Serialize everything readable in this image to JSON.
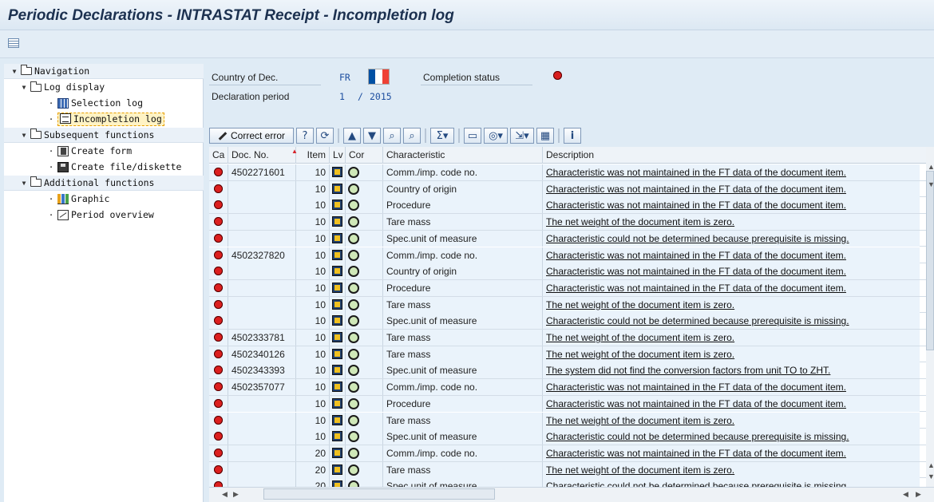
{
  "window": {
    "title": "Periodic Declarations - INTRASTAT Receipt - Incompletion log"
  },
  "navigation": [
    {
      "label": "Navigation",
      "type": "folder",
      "expanded": true,
      "level": 0
    },
    {
      "label": "Log display",
      "type": "folder",
      "expanded": true,
      "level": 1
    },
    {
      "label": "Selection log",
      "type": "item",
      "icon": "table-icon",
      "level": 2
    },
    {
      "label": "Incompletion log",
      "type": "item",
      "icon": "log-icon",
      "level": 2,
      "selected": true
    },
    {
      "label": "Subsequent functions",
      "type": "folder",
      "expanded": true,
      "level": 1
    },
    {
      "label": "Create form",
      "type": "item",
      "icon": "form-icon",
      "level": 2
    },
    {
      "label": "Create file/diskette",
      "type": "item",
      "icon": "disk-icon",
      "level": 2
    },
    {
      "label": "Additional functions",
      "type": "folder",
      "expanded": true,
      "level": 1
    },
    {
      "label": "Graphic",
      "type": "item",
      "icon": "graphic-icon",
      "level": 2
    },
    {
      "label": "Period overview",
      "type": "item",
      "icon": "overview-icon",
      "level": 2
    }
  ],
  "header": {
    "country_label": "Country of Dec.",
    "country_value": "FR",
    "completion_label": "Completion status",
    "period_label": "Declaration period",
    "period_month": "1",
    "period_sep": "/",
    "period_year": "2015",
    "flag_colors": [
      "#0050a4",
      "#ffffff",
      "#ef4135"
    ],
    "status_color": "#d81e1e"
  },
  "toolbar": {
    "correct_error": "Correct error"
  },
  "columns": [
    "Ca",
    "Doc. No.",
    "Item",
    "Lv",
    "Cor",
    "Characteristic",
    "Description"
  ],
  "rows": [
    {
      "doc": "4502271601",
      "item": "10",
      "char": "Comm./imp. code no.",
      "desc": "Characteristic was not maintained in the FT data of the document item."
    },
    {
      "doc": "",
      "item": "10",
      "char": "Country of origin",
      "desc": "Characteristic was not maintained in the FT data of the document item."
    },
    {
      "doc": "",
      "item": "10",
      "char": "Procedure",
      "desc": "Characteristic was not maintained in the FT data of the document item."
    },
    {
      "doc": "",
      "item": "10",
      "char": "Tare mass",
      "desc": "The net weight of the document item is zero."
    },
    {
      "doc": "",
      "item": "10",
      "char": "Spec.unit of measure",
      "desc": "Characteristic could not be determined because prerequisite is missing."
    },
    {
      "doc": "4502327820",
      "item": "10",
      "char": "Comm./imp. code no.",
      "desc": "Characteristic was not maintained in the FT data of the document item."
    },
    {
      "doc": "",
      "item": "10",
      "char": "Country of origin",
      "desc": "Characteristic was not maintained in the FT data of the document item."
    },
    {
      "doc": "",
      "item": "10",
      "char": "Procedure",
      "desc": "Characteristic was not maintained in the FT data of the document item."
    },
    {
      "doc": "",
      "item": "10",
      "char": "Tare mass",
      "desc": "The net weight of the document item is zero."
    },
    {
      "doc": "",
      "item": "10",
      "char": "Spec.unit of measure",
      "desc": "Characteristic could not be determined because prerequisite is missing."
    },
    {
      "doc": "4502333781",
      "item": "10",
      "char": "Tare mass",
      "desc": "The net weight of the document item is zero."
    },
    {
      "doc": "4502340126",
      "item": "10",
      "char": "Tare mass",
      "desc": "The net weight of the document item is zero."
    },
    {
      "doc": "4502343393",
      "item": "10",
      "char": "Spec.unit of measure",
      "desc": "The system did not find the conversion factors from unit TO to ZHT."
    },
    {
      "doc": "4502357077",
      "item": "10",
      "char": "Comm./imp. code no.",
      "desc": "Characteristic was not maintained in the FT data of the document item."
    },
    {
      "doc": "",
      "item": "10",
      "char": "Procedure",
      "desc": "Characteristic was not maintained in the FT data of the document item."
    },
    {
      "doc": "",
      "item": "10",
      "char": "Tare mass",
      "desc": "The net weight of the document item is zero."
    },
    {
      "doc": "",
      "item": "10",
      "char": "Spec.unit of measure",
      "desc": "Characteristic could not be determined because prerequisite is missing."
    },
    {
      "doc": "",
      "item": "20",
      "char": "Comm./imp. code no.",
      "desc": "Characteristic was not maintained in the FT data of the document item."
    },
    {
      "doc": "",
      "item": "20",
      "char": "Tare mass",
      "desc": "The net weight of the document item is zero."
    },
    {
      "doc": "",
      "item": "20",
      "char": "Spec.unit of measure",
      "desc": "Characteristic could not be determined because prerequisite is missing."
    }
  ]
}
